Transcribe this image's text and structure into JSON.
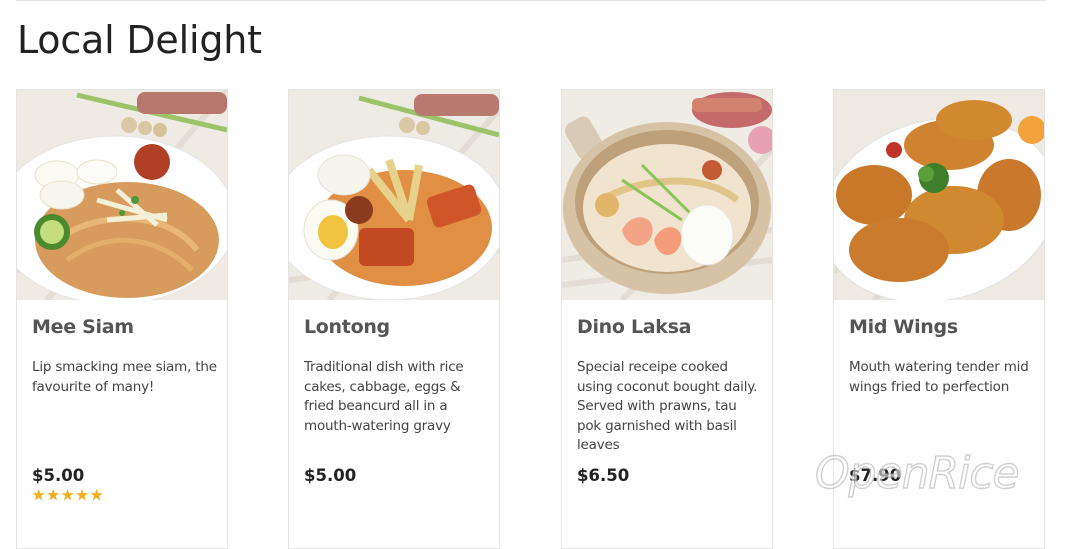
{
  "section": {
    "title": "Local Delight"
  },
  "menu_items": [
    {
      "name": "Mee Siam",
      "description": "Lip smacking mee siam, the favourite of many!",
      "price": "$5.00",
      "rating": 5,
      "image_icon": "mee-siam-photo"
    },
    {
      "name": "Lontong",
      "description": "Traditional dish with rice cakes, cabbage, eggs & fried beancurd all in a mouth-watering gravy",
      "price": "$5.00",
      "image_icon": "lontong-photo"
    },
    {
      "name": "Dino Laksa",
      "description": "Special receipe cooked using coconut bought daily. Served with prawns, tau pok garnished with basil leaves",
      "price": "$6.50",
      "image_icon": "laksa-photo"
    },
    {
      "name": "Mid Wings",
      "description": "Mouth watering tender mid wings fried to perfection",
      "price": "$7.90",
      "image_icon": "chicken-wings-photo"
    }
  ],
  "watermark": {
    "text": "OpenRice"
  },
  "colors": {
    "star": "#f2b01e",
    "card_border": "#e4e4e4",
    "title_text": "#222222"
  }
}
